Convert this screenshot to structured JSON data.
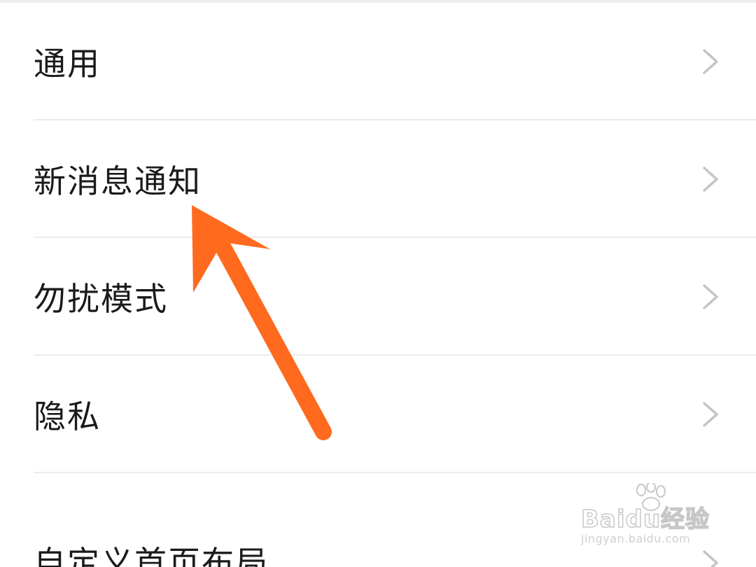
{
  "settings": {
    "items": [
      {
        "label": "通用",
        "icon": "chevron-right-icon"
      },
      {
        "label": "新消息通知",
        "icon": "chevron-right-icon"
      },
      {
        "label": "勿扰模式",
        "icon": "chevron-right-icon"
      },
      {
        "label": "隐私",
        "icon": "chevron-right-icon"
      },
      {
        "label": "自定义首页布局",
        "icon": "chevron-right-icon"
      }
    ]
  },
  "annotation": {
    "type": "arrow",
    "color": "#ff6a1f",
    "points_to": "新消息通知"
  },
  "watermark": {
    "brand": "Baidu经验",
    "url": "jingyan.baidu.com"
  },
  "colors": {
    "text": "#1a1a1a",
    "chevron": "#c4c4c4",
    "divider": "#ececec",
    "top_strip": "#eeeef2"
  }
}
